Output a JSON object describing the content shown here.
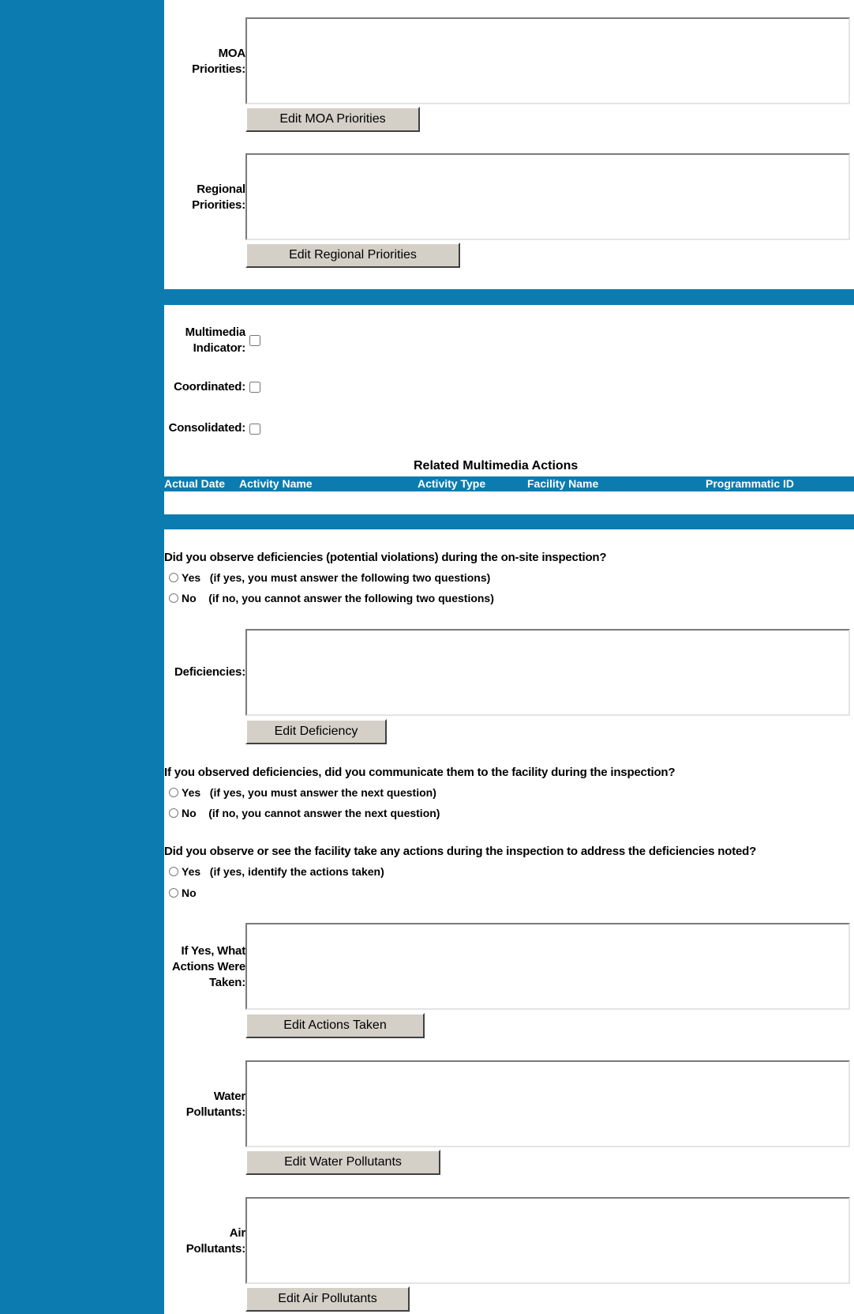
{
  "fields": {
    "moa": {
      "label": "MOA\nPriorities:",
      "value": "",
      "button": "Edit MOA Priorities"
    },
    "regional": {
      "label": "Regional\nPriorities:",
      "value": "",
      "button": "Edit Regional Priorities"
    },
    "deficiencies": {
      "label": "Deficiencies:",
      "value": "",
      "button": "Edit Deficiency"
    },
    "actions_taken": {
      "label": "If Yes, What\nActions Were\nTaken:",
      "value": "",
      "button": "Edit Actions Taken"
    },
    "water": {
      "label": "Water\nPollutants:",
      "value": "",
      "button": "Edit Water Pollutants"
    },
    "air": {
      "label": "Air\nPollutants:",
      "value": "",
      "button": "Edit Air Pollutants"
    }
  },
  "checkboxes": {
    "multimedia": {
      "label": "Multimedia\nIndicator:",
      "checked": false
    },
    "coordinated": {
      "label": "Coordinated:",
      "checked": false
    },
    "consolidated": {
      "label": "Consolidated:",
      "checked": false
    }
  },
  "related_table": {
    "caption": "Related Multimedia Actions",
    "columns": [
      "Actual Date",
      "Activity Name",
      "Activity Type",
      "Facility Name",
      "Programmatic ID"
    ],
    "rows": []
  },
  "questions": {
    "q1": {
      "text": "Did you observe deficiencies (potential violations) during the on-site inspection?",
      "options": [
        "Yes   (if yes, you must answer the following two questions)",
        "No    (if no, you cannot answer the following two questions)"
      ]
    },
    "q2": {
      "text": "If you observed deficiencies, did you communicate them to the facility during the inspection?",
      "options": [
        "Yes   (if yes, you must answer the next question)",
        "No    (if no, you cannot answer the next question)"
      ]
    },
    "q3": {
      "text": "Did you observe or see the facility take any actions during the inspection to address the deficiencies noted?",
      "options": [
        "Yes   (if yes, identify the actions taken)",
        "No"
      ]
    }
  },
  "colors": {
    "accent": "#0c7cb0",
    "button_face": "#d4d0c8"
  }
}
